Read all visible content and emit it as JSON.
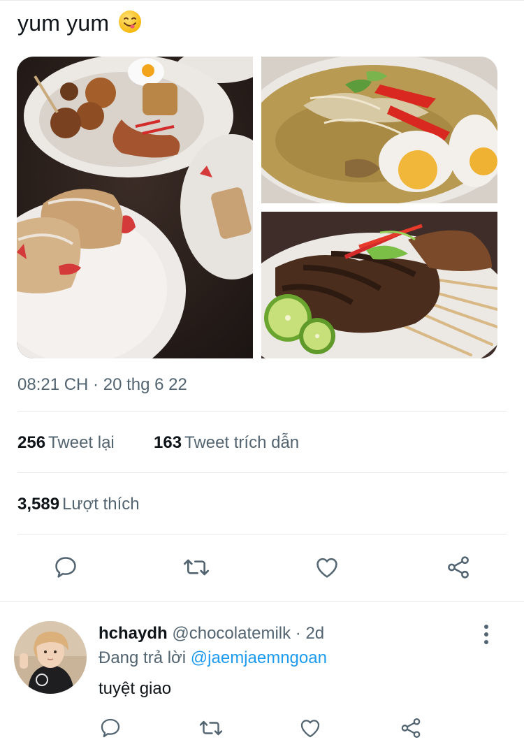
{
  "tweet": {
    "text": "yum yum",
    "emoji": "face-savoring-food-emoji",
    "timestamp": "08:21 CH · 20 thg 6 22",
    "stats": {
      "retweets": "256",
      "retweets_label": "Tweet lại",
      "quotes": "163",
      "quotes_label": "Tweet trích dẫn",
      "likes": "3,589",
      "likes_label": "Lượt thích"
    },
    "actions": [
      "reply-icon",
      "retweet-icon",
      "like-icon",
      "share-icon"
    ]
  },
  "reply": {
    "name": "hchaydh",
    "handle": "@chocolatemilk",
    "separator": " · ",
    "time": "2d",
    "replying_prefix": "Đang trả lời",
    "replying_to": "@jaemjaemngoan",
    "text": "tuyệt giao",
    "actions": [
      "reply-icon",
      "retweet-icon",
      "like-icon",
      "share-icon"
    ]
  },
  "colors": {
    "text": "#0f1419",
    "secondary": "#536471",
    "link": "#1d9bf0",
    "divider": "#e6e9ec"
  }
}
